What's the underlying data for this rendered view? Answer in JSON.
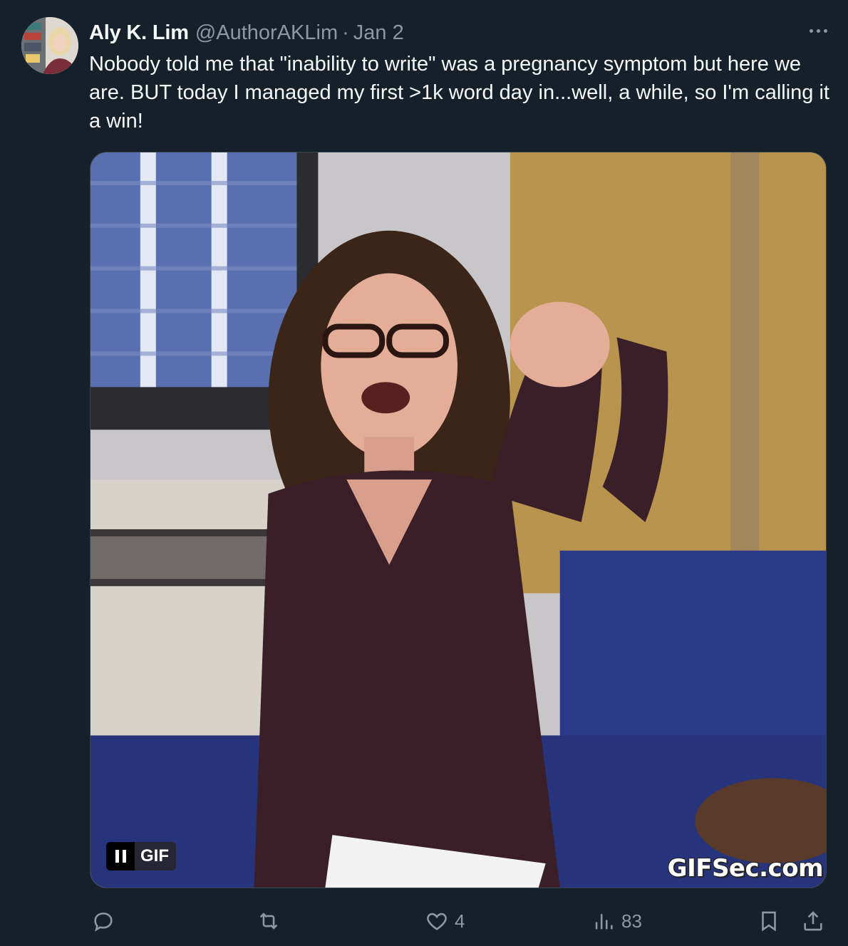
{
  "tweet": {
    "author_name": "Aly K. Lim",
    "handle": "@AuthorAKLim",
    "separator": "·",
    "date": "Jan 2",
    "text": "Nobody told me that \"inability to write\" was a pregnancy symptom but here we are. BUT today I managed my first >1k word day in...well, a while, so I'm calling it a win!",
    "more_icon": "ellipsis-icon"
  },
  "media": {
    "badge_label": "GIF",
    "pause_icon": "pause-icon",
    "watermark": "GIFSec.com"
  },
  "actions": {
    "reply": {
      "icon": "reply-icon",
      "count": ""
    },
    "retweet": {
      "icon": "retweet-icon",
      "count": ""
    },
    "like": {
      "icon": "heart-icon",
      "count": "4"
    },
    "views": {
      "icon": "views-icon",
      "count": "83"
    },
    "bookmark": {
      "icon": "bookmark-icon"
    },
    "share": {
      "icon": "share-icon"
    }
  },
  "colors": {
    "background": "#15202b",
    "primary_text": "#f7f9f9",
    "secondary_text": "#8b98a5",
    "border": "#38444d"
  }
}
